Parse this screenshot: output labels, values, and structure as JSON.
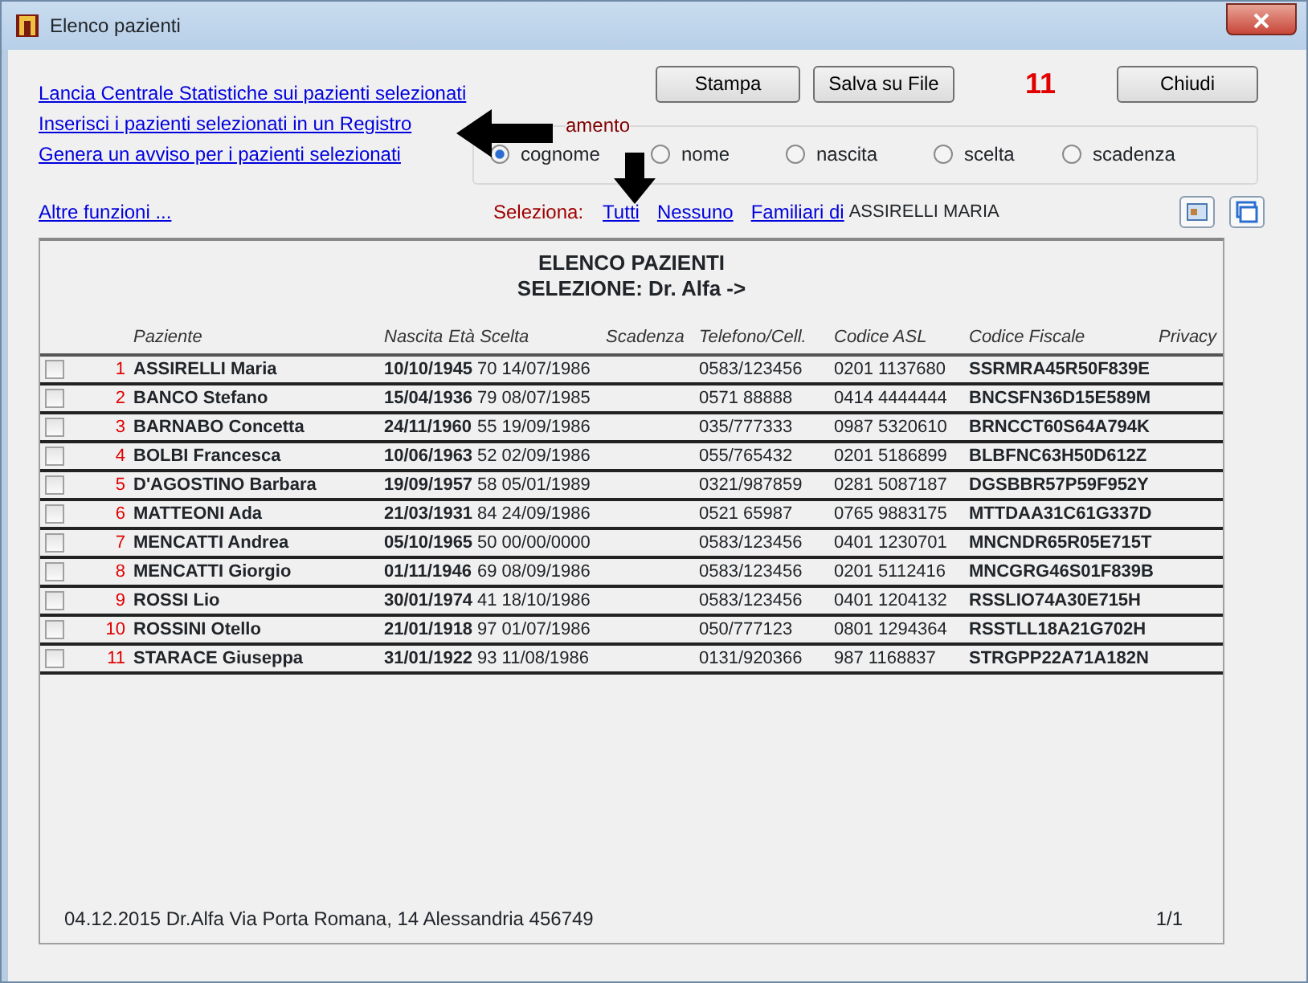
{
  "window": {
    "title": "Elenco pazienti"
  },
  "links": [
    "Lancia Centrale Statistiche sui pazienti selezionati",
    "Inserisci i pazienti selezionati in un Registro",
    "Genera un avviso per i pazienti selezionati"
  ],
  "buttons": [
    "Stampa",
    "Salva su File",
    "Chiudi"
  ],
  "count": "11",
  "sort": {
    "label": "amento",
    "options": [
      {
        "label": "cognome",
        "selected": true
      },
      {
        "label": "nome",
        "selected": false
      },
      {
        "label": "nascita",
        "selected": false
      },
      {
        "label": "scelta",
        "selected": false
      },
      {
        "label": "scadenza",
        "selected": false
      }
    ]
  },
  "more_link": "Altre funzioni ...",
  "selection": {
    "label": "Seleziona:",
    "links": [
      "Tutti",
      "Nessuno",
      "Familiari di"
    ],
    "name": "ASSIRELLI MARIA"
  },
  "report": {
    "title": "ELENCO PAZIENTI",
    "subtitle": "SELEZIONE: Dr.  Alfa ->",
    "columns": [
      "Paziente",
      "Nascita",
      "Età Scelta",
      "Scadenza",
      "Telefono/Cell.",
      "Codice ASL",
      "Codice Fiscale",
      "Privacy"
    ],
    "rows": [
      {
        "checked": false,
        "number": "1",
        "name": "ASSIRELLI Maria",
        "birth": "10/10/1945",
        "age": "70",
        "choice": "14/07/1986",
        "phone": "0583/123456",
        "asl": "0201 1137680",
        "fiscal": "SSRMRA45R50F839E"
      },
      {
        "checked": false,
        "number": "2",
        "name": "BANCO Stefano",
        "birth": "15/04/1936",
        "age": "79",
        "choice": "08/07/1985",
        "phone": "0571 88888",
        "asl": "0414 4444444",
        "fiscal": "BNCSFN36D15E589M"
      },
      {
        "checked": false,
        "number": "3",
        "name": "BARNABO Concetta",
        "birth": "24/11/1960",
        "age": "55",
        "choice": "19/09/1986",
        "phone": "035/777333",
        "asl": "0987 5320610",
        "fiscal": "BRNCCT60S64A794K"
      },
      {
        "checked": false,
        "number": "4",
        "name": "BOLBI Francesca",
        "birth": "10/06/1963",
        "age": "52",
        "choice": "02/09/1986",
        "phone": "055/765432",
        "asl": "0201 5186899",
        "fiscal": "BLBFNC63H50D612Z"
      },
      {
        "checked": false,
        "number": "5",
        "name": "D'AGOSTINO Barbara",
        "birth": "19/09/1957",
        "age": "58",
        "choice": "05/01/1989",
        "phone": "0321/987859",
        "asl": "0281 5087187",
        "fiscal": "DGSBBR57P59F952Y"
      },
      {
        "checked": false,
        "number": "6",
        "name": "MATTEONI Ada",
        "birth": "21/03/1931",
        "age": "84",
        "choice": "24/09/1986",
        "phone": "0521 65987",
        "asl": "0765 9883175",
        "fiscal": "MTTDAA31C61G337D"
      },
      {
        "checked": false,
        "number": "7",
        "name": "MENCATTI Andrea",
        "birth": "05/10/1965",
        "age": "50",
        "choice": "00/00/0000",
        "phone": "0583/123456",
        "asl": "0401 1230701",
        "fiscal": "MNCNDR65R05E715T"
      },
      {
        "checked": false,
        "number": "8",
        "name": "MENCATTI Giorgio",
        "birth": "01/11/1946",
        "age": "69",
        "choice": "08/09/1986",
        "phone": "0583/123456",
        "asl": "0201 5112416",
        "fiscal": "MNCGRG46S01F839B"
      },
      {
        "checked": false,
        "number": "9",
        "name": "ROSSI Lio",
        "birth": "30/01/1974",
        "age": "41",
        "choice": "18/10/1986",
        "phone": "0583/123456",
        "asl": "0401 1204132",
        "fiscal": "RSSLIO74A30E715H"
      },
      {
        "checked": false,
        "number": "10",
        "name": "ROSSINI Otello",
        "birth": "21/01/1918",
        "age": "97",
        "choice": "01/07/1986",
        "phone": "050/777123",
        "asl": "0801 1294364",
        "fiscal": "RSSTLL18A21G702H"
      },
      {
        "checked": false,
        "number": "11",
        "name": "STARACE Giuseppa",
        "birth": "31/01/1922",
        "age": "93",
        "choice": "11/08/1986",
        "phone": "0131/920366",
        "asl": "987 1168837",
        "fiscal": "STRGPP22A71A182N"
      }
    ]
  },
  "footer": {
    "text": "04.12.2015 Dr.Alfa Via Porta Romana, 14 Alessandria 456749",
    "page": "1/1"
  }
}
